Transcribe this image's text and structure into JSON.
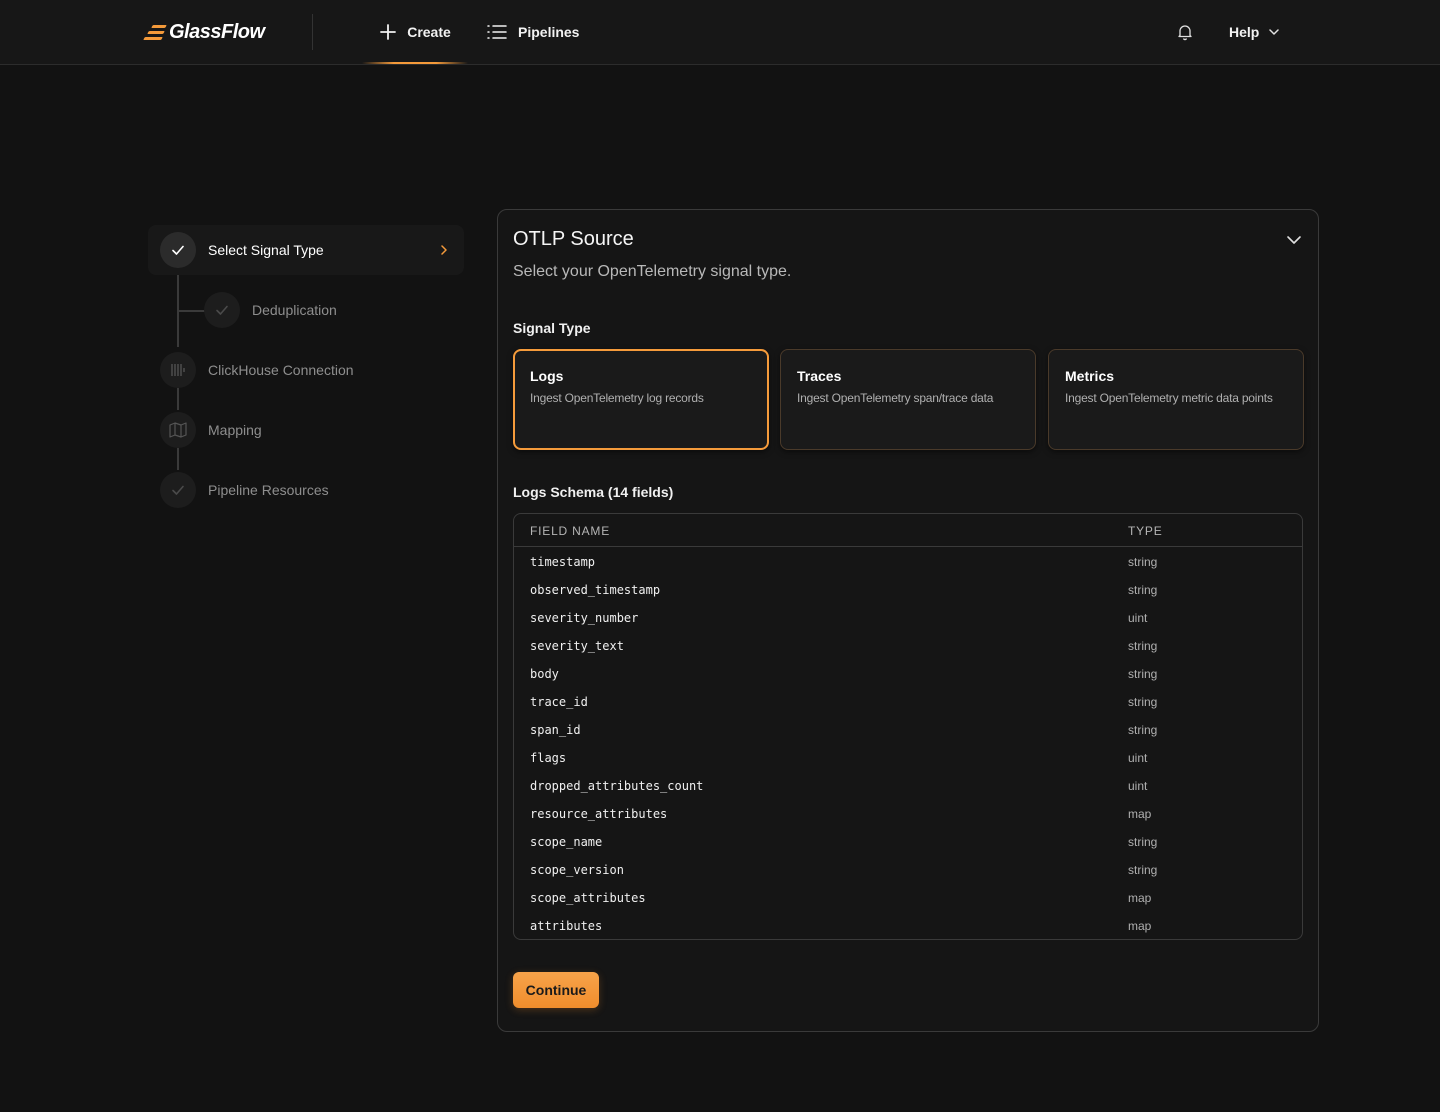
{
  "header": {
    "logo_text": "GlassFlow",
    "nav": {
      "create": "Create",
      "pipelines": "Pipelines"
    },
    "help": "Help",
    "accent_color": "#f49a3a"
  },
  "steps": [
    {
      "label": "Select Signal Type",
      "state": "active",
      "icon": "check-icon"
    },
    {
      "label": "Deduplication",
      "state": "completed",
      "icon": "check-icon"
    },
    {
      "label": "ClickHouse Connection",
      "state": "pending",
      "icon": "clickhouse-icon"
    },
    {
      "label": "Mapping",
      "state": "pending",
      "icon": "map-icon"
    },
    {
      "label": "Pipeline Resources",
      "state": "pending",
      "icon": "check-icon"
    }
  ],
  "card": {
    "title": "OTLP Source",
    "subtitle": "Select your OpenTelemetry signal type.",
    "signal_type_label": "Signal Type",
    "signal_types": [
      {
        "title": "Logs",
        "desc": "Ingest OpenTelemetry log records",
        "selected": true
      },
      {
        "title": "Traces",
        "desc": "Ingest OpenTelemetry span/trace data",
        "selected": false
      },
      {
        "title": "Metrics",
        "desc": "Ingest OpenTelemetry metric data points",
        "selected": false
      }
    ],
    "schema_label": "Logs Schema (14 fields)",
    "table": {
      "headers": {
        "name": "FIELD NAME",
        "type": "TYPE"
      },
      "rows": [
        {
          "name": "timestamp",
          "type": "string"
        },
        {
          "name": "observed_timestamp",
          "type": "string"
        },
        {
          "name": "severity_number",
          "type": "uint"
        },
        {
          "name": "severity_text",
          "type": "string"
        },
        {
          "name": "body",
          "type": "string"
        },
        {
          "name": "trace_id",
          "type": "string"
        },
        {
          "name": "span_id",
          "type": "string"
        },
        {
          "name": "flags",
          "type": "uint"
        },
        {
          "name": "dropped_attributes_count",
          "type": "uint"
        },
        {
          "name": "resource_attributes",
          "type": "map"
        },
        {
          "name": "scope_name",
          "type": "string"
        },
        {
          "name": "scope_version",
          "type": "string"
        },
        {
          "name": "scope_attributes",
          "type": "map"
        },
        {
          "name": "attributes",
          "type": "map"
        }
      ]
    },
    "continue_label": "Continue"
  }
}
